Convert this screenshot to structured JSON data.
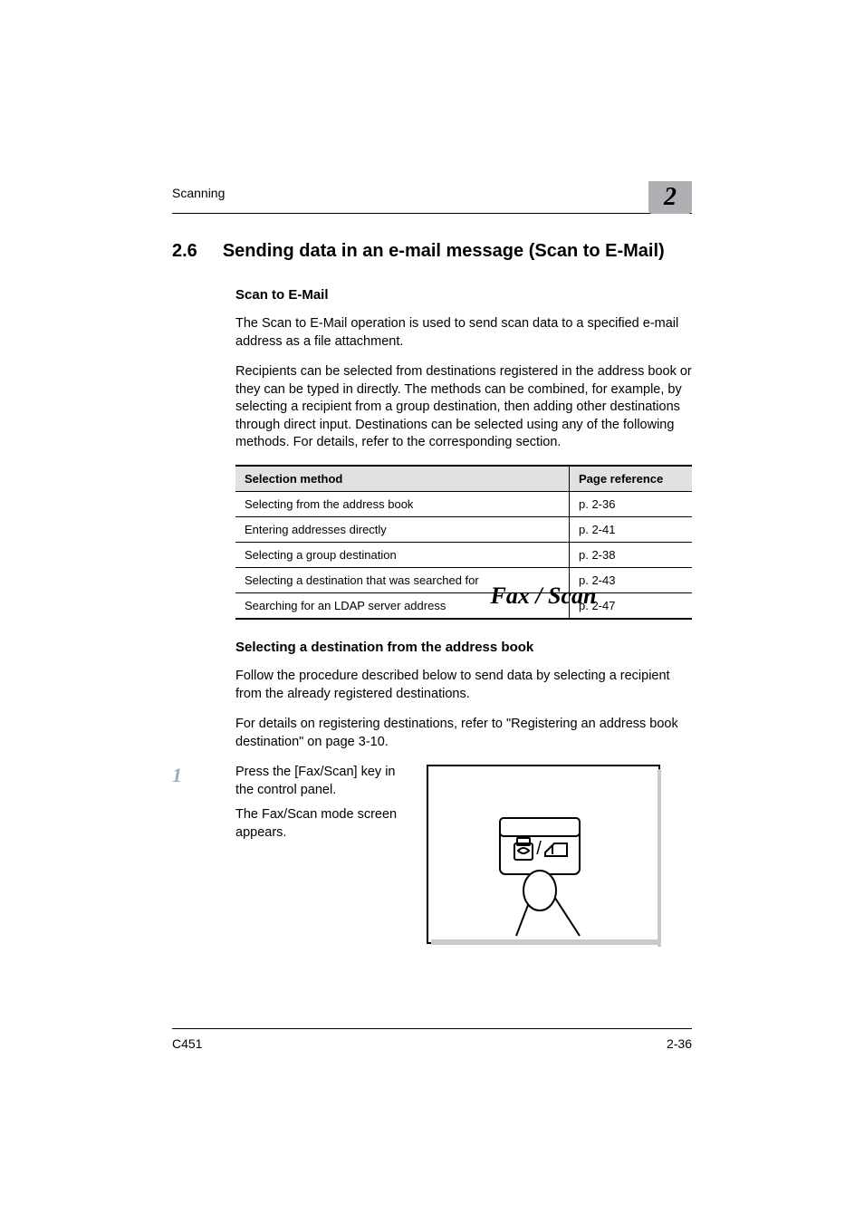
{
  "running_head": {
    "section_label": "Scanning",
    "chapter_number": "2"
  },
  "section": {
    "number": "2.6",
    "title": "Sending data in an e-mail message (Scan to E-Mail)"
  },
  "sub1": {
    "heading": "Scan to E-Mail",
    "para1": "The Scan to E-Mail operation is used to send scan data to a specified e-mail address as a file attachment.",
    "para2": "Recipients can be selected from destinations registered in the address book or they can be typed in directly. The methods can be combined, for example, by selecting a recipient from a group destination, then adding other destinations through direct input. Destinations can be selected using any of the following methods. For details, refer to the corresponding section."
  },
  "table": {
    "headers": {
      "method": "Selection method",
      "ref": "Page reference"
    },
    "rows": [
      {
        "method": "Selecting from the address book",
        "ref": "p. 2-36"
      },
      {
        "method": "Entering addresses directly",
        "ref": "p. 2-41"
      },
      {
        "method": "Selecting a group destination",
        "ref": "p. 2-38"
      },
      {
        "method": "Selecting a destination that was searched for",
        "ref": "p. 2-43"
      },
      {
        "method": "Searching for an LDAP server address",
        "ref": "p. 2-47"
      }
    ]
  },
  "sub2": {
    "heading": "Selecting a destination from the address book",
    "para1": "Follow the procedure described below to send data by selecting a recipient from the already registered destinations.",
    "para2": "For details on registering destinations, refer to \"Registering an address book destination\" on page 3-10."
  },
  "step1": {
    "num": "1",
    "line1": "Press the [Fax/Scan] key in the control panel.",
    "line2": "The Fax/Scan mode screen appears.",
    "key_label": "Fax / Scan"
  },
  "footer": {
    "model": "C451",
    "page": "2-36"
  }
}
